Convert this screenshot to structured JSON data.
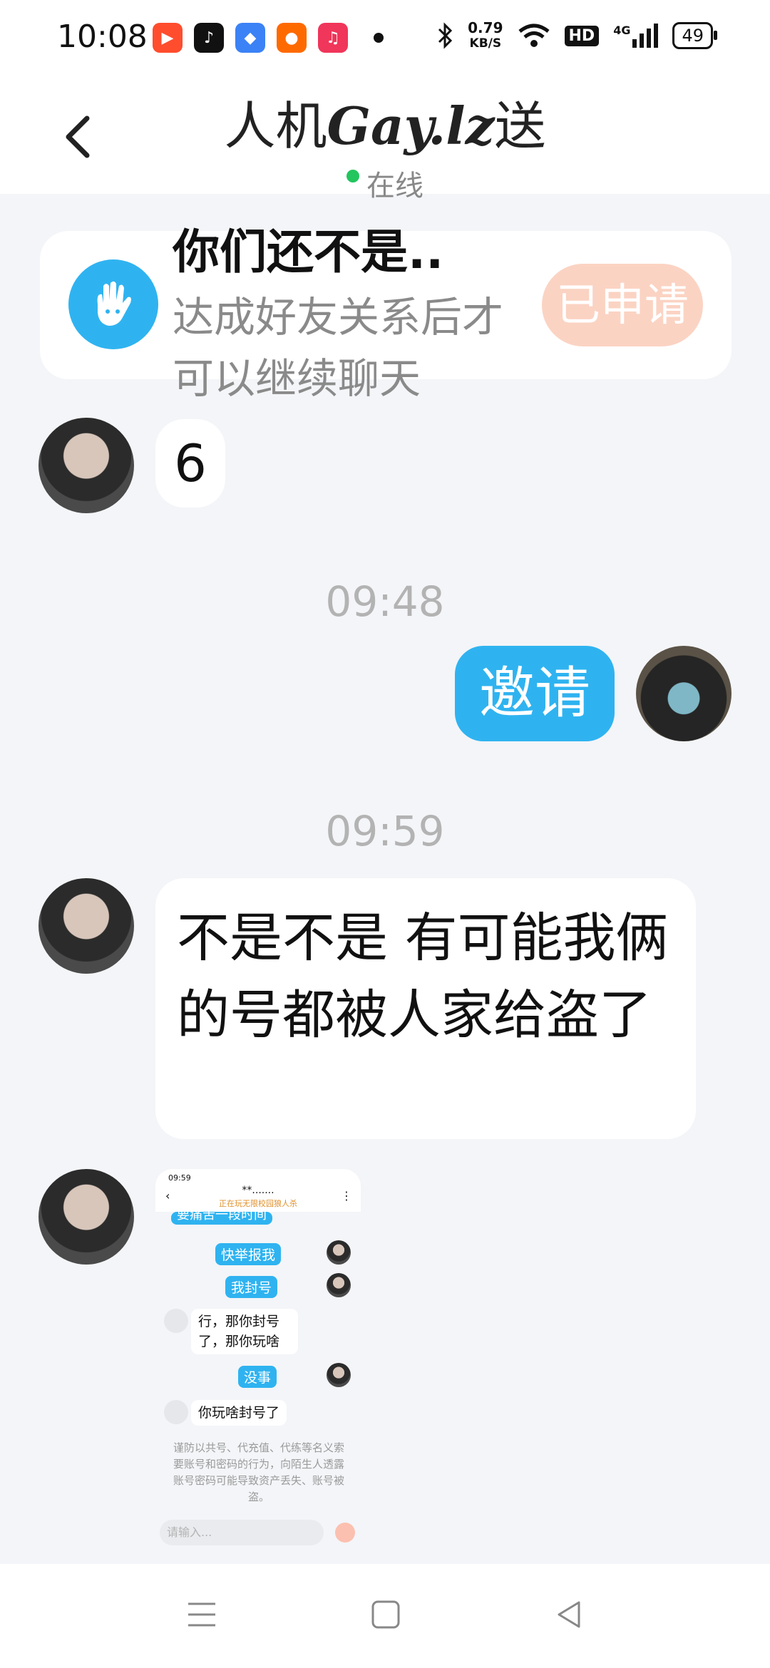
{
  "status_bar": {
    "time": "10:08",
    "speed_value": "0.79",
    "speed_unit": "KB/S",
    "hd": "HD",
    "network": "4G",
    "battery": "49",
    "app_icons": [
      "video-app-icon",
      "tiktok-icon",
      "browser-icon",
      "kuaishou-icon",
      "music-icon"
    ]
  },
  "header": {
    "title_prefix": "人机",
    "title_fancy": "Gay.lz",
    "title_suffix": "送",
    "status": "在线"
  },
  "banner": {
    "title": "你们还不是..",
    "subtitle": "达成好友关系后才可以继续聊天",
    "button": "已申请"
  },
  "messages": {
    "m1": "6",
    "time1": "09:48",
    "m2": "邀请",
    "time2": "09:59",
    "m3": "不是不是 有可能我俩的号都被人家给盗了"
  },
  "embedded_screenshot": {
    "time": "09:59",
    "title": "**.......",
    "subtitle": "正在玩无限校园狼人杀",
    "partial": "要痛苦一段时间",
    "r1": "快举报我",
    "r2": "我封号",
    "l1": "行，那你封号了，那你玩啥",
    "r3": "没事",
    "l2": "你玩啥封号了",
    "warning": "谨防以共号、代充值、代练等名义索要账号和密码的行为，向陌生人透露账号密码可能导致资产丢失、账号被盗。",
    "input_placeholder": "请输入..."
  },
  "colors": {
    "accent": "#2fb3f0",
    "applied_button": "#fbd3c3",
    "online": "#22c55e"
  }
}
